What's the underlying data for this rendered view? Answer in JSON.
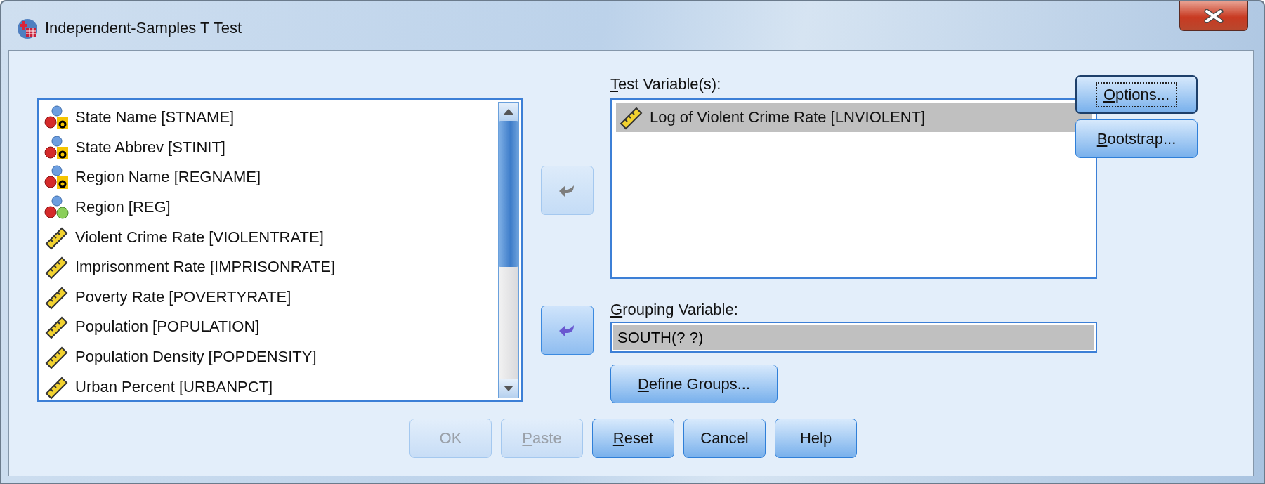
{
  "window": {
    "title": "Independent-Samples T Test"
  },
  "variables": {
    "items": [
      {
        "label": "State Name [STNAME]",
        "kind": "string",
        "selected": false
      },
      {
        "label": "State Abbrev [STINIT]",
        "kind": "string",
        "selected": false
      },
      {
        "label": "Region Name [REGNAME]",
        "kind": "string",
        "selected": false
      },
      {
        "label": "Region [REG]",
        "kind": "nominal",
        "selected": false
      },
      {
        "label": "Violent Crime Rate [VIOLENTRATE]",
        "kind": "scale",
        "selected": false
      },
      {
        "label": "Imprisonment Rate [IMPRISONRATE]",
        "kind": "scale",
        "selected": false
      },
      {
        "label": "Poverty Rate [POVERTYRATE]",
        "kind": "scale",
        "selected": false
      },
      {
        "label": "Population  [POPULATION]",
        "kind": "scale",
        "selected": false
      },
      {
        "label": "Population Density [POPDENSITY]",
        "kind": "scale",
        "selected": false
      },
      {
        "label": "Urban Percent [URBANPCT]",
        "kind": "scale",
        "selected": false
      }
    ]
  },
  "move_buttons": [
    {
      "disabled": true
    },
    {
      "disabled": false
    }
  ],
  "test_variables": {
    "label": "Test Variable(s):",
    "mnemonic": true,
    "items": [
      {
        "label": "Log of Violent Crime Rate [LNVIOLENT]",
        "kind": "scale",
        "selected": true
      }
    ]
  },
  "grouping_variable": {
    "label": "Grouping Variable:",
    "mnemonic": true,
    "value": "SOUTH(? ?)",
    "selected": true
  },
  "define_groups_button": {
    "label": "Define Groups...",
    "mnemonic": true,
    "disabled": false
  },
  "side_buttons": [
    {
      "label": "Options...",
      "mnemonic": true,
      "focused": true,
      "disabled": false
    },
    {
      "label": "Bootstrap...",
      "mnemonic": true,
      "focused": false,
      "disabled": false
    }
  ],
  "buttons": [
    {
      "label": "OK",
      "mnemonic": false,
      "disabled": true
    },
    {
      "label": "Paste",
      "mnemonic": true,
      "disabled": true
    },
    {
      "label": "Reset",
      "mnemonic": true,
      "disabled": false
    },
    {
      "label": "Cancel",
      "mnemonic": false,
      "disabled": false
    },
    {
      "label": "Help",
      "mnemonic": false,
      "disabled": false
    }
  ]
}
